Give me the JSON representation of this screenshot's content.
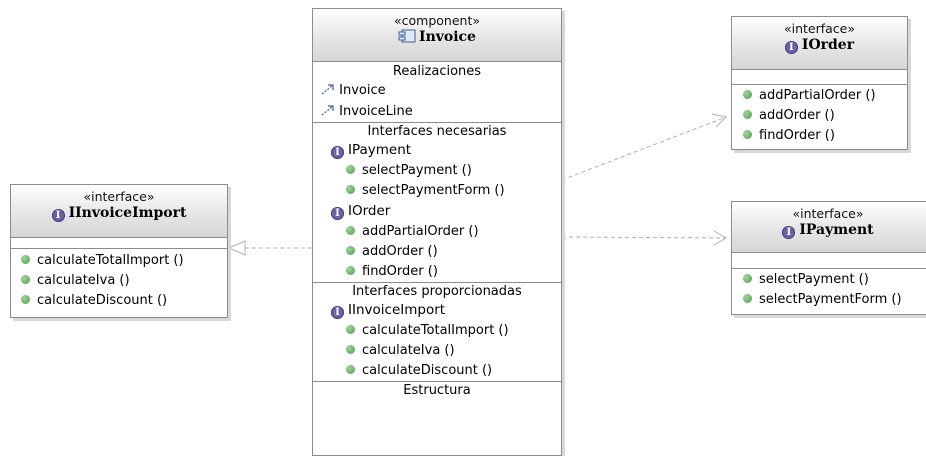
{
  "component": {
    "stereotype": "«component»",
    "name": "Invoice",
    "realizations_title": "Realizaciones",
    "realizations": [
      "Invoice",
      "InvoiceLine"
    ],
    "required_title": "Interfaces necesarias",
    "required": [
      {
        "name": "IPayment",
        "ops": [
          "selectPayment ()",
          "selectPaymentForm ()"
        ]
      },
      {
        "name": "IOrder",
        "ops": [
          "addPartialOrder ()",
          "addOrder ()",
          "findOrder ()"
        ]
      }
    ],
    "provided_title": "Interfaces proporcionadas",
    "provided": [
      {
        "name": "IInvoiceImport",
        "ops": [
          "calculateTotalImport ()",
          "calculateIva ()",
          "calculateDiscount ()"
        ]
      }
    ],
    "structure_title": "Estructura"
  },
  "iinvoiceimport": {
    "stereotype": "«interface»",
    "name": "IInvoiceImport",
    "ops": [
      "calculateTotalImport ()",
      "calculateIva ()",
      "calculateDiscount ()"
    ]
  },
  "iorder": {
    "stereotype": "«interface»",
    "name": "IOrder",
    "ops": [
      "addPartialOrder ()",
      "addOrder ()",
      "findOrder ()"
    ]
  },
  "ipayment": {
    "stereotype": "«interface»",
    "name": "IPayment",
    "ops": [
      "selectPayment ()",
      "selectPaymentForm ()"
    ]
  },
  "icons": {
    "interface": "interface-i-icon",
    "component": "component-icon",
    "operation": "operation-dot-icon",
    "realization": "realization-arrow-icon"
  },
  "colors": {
    "interface_badge": "#6c5fa3",
    "operation_dot": "#5aa654",
    "border": "#8c8c8c",
    "connector": "#b0b0b0"
  }
}
